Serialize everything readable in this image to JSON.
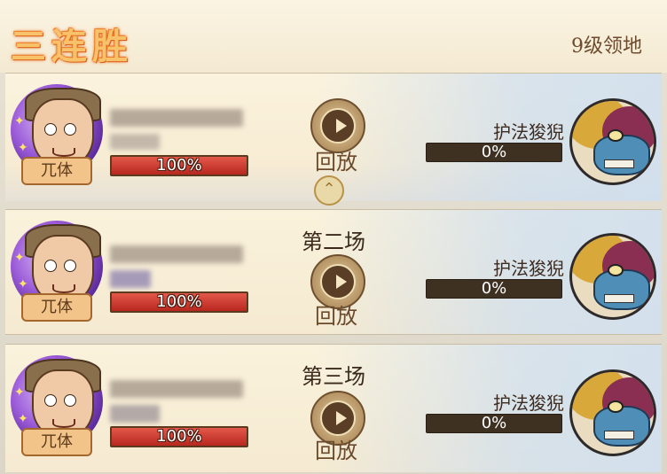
{
  "header": {
    "title": "三连胜",
    "level_label": "9级领地"
  },
  "rounds": [
    {
      "label": "",
      "player": {
        "class_tag": "兀体",
        "hp_text": "100%",
        "hp_fraction": 1.0
      },
      "replay_label": "回放",
      "enemy": {
        "name": "护法狻猊",
        "hp_text": "0%",
        "hp_fraction": 0.0
      }
    },
    {
      "label": "第二场",
      "player": {
        "class_tag": "兀体",
        "hp_text": "100%",
        "hp_fraction": 1.0
      },
      "replay_label": "回放",
      "enemy": {
        "name": "护法狻猊",
        "hp_text": "0%",
        "hp_fraction": 0.0
      }
    },
    {
      "label": "第三场",
      "player": {
        "class_tag": "兀体",
        "hp_text": "100%",
        "hp_fraction": 1.0
      },
      "replay_label": "回放",
      "enemy": {
        "name": "护法狻猊",
        "hp_text": "0%",
        "hp_fraction": 0.0
      }
    }
  ],
  "icons": {
    "replay": "replay-play-icon",
    "collapse": "chevron-up-icon",
    "player_avatar": "player-avatar-icon",
    "enemy_avatar": "suanni-boss-avatar-icon"
  },
  "colors": {
    "hp_fill": "#c12e24",
    "hp_track": "#e8b46a",
    "enemy_track": "#3f3122",
    "title_glow": "#e86d1c",
    "aura": "#9b5bd8"
  }
}
